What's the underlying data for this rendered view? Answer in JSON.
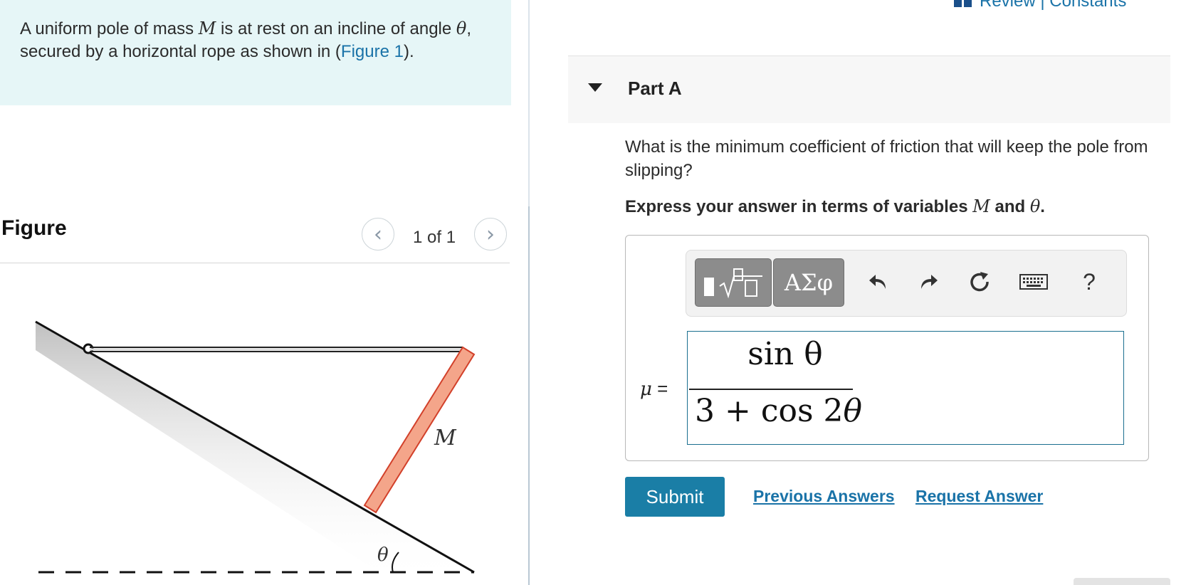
{
  "intro": {
    "text_before_M": "A uniform pole of mass ",
    "var_M": "M",
    "text_after_M": " is at rest on an incline of angle ",
    "var_theta": "θ",
    "text_after_theta": ", secured by a horizontal rope as shown in (",
    "figure_link": "Figure 1",
    "text_end": ")."
  },
  "figure_panel": {
    "title": "Figure",
    "pager": "1 of 1",
    "prev_icon": "chevron-left-icon",
    "next_icon": "chevron-right-icon",
    "labels": {
      "mass": "M",
      "angle": "θ"
    },
    "colors": {
      "pole_fill": "#f4a58a",
      "pole_stroke": "#d2402a",
      "incline_line": "#111111",
      "rope": "#333333"
    }
  },
  "header": {
    "review_link": "Review | Constants",
    "review_icon": "book-icon"
  },
  "part": {
    "title": "Part A",
    "collapse_icon": "caret-down-icon"
  },
  "question": {
    "text": "What is the minimum coefficient of friction that will keep the pole from slipping?",
    "instruction_before": "Express your answer in terms of variables ",
    "instruction_var_M": "M",
    "instruction_and": " and ",
    "instruction_var_theta": "θ",
    "instruction_end": "."
  },
  "toolbar": {
    "templates_icon": "templates-sqrt-icon",
    "symbols_label": "ΑΣφ",
    "undo_icon": "undo-icon",
    "redo_icon": "redo-icon",
    "reset_icon": "reset-icon",
    "keyboard_icon": "keyboard-icon",
    "help_label": "?"
  },
  "answer": {
    "variable": "μ",
    "equals": " =",
    "numerator": "sin θ",
    "denominator_prefix": "3 + cos 2",
    "denominator_var": "θ"
  },
  "actions": {
    "submit": "Submit",
    "previous_answers": "Previous Answers",
    "request_answer": "Request Answer"
  },
  "colors": {
    "intro_bg": "#e6f6f7",
    "accent": "#1a7ea6",
    "link": "#1a73a8"
  }
}
